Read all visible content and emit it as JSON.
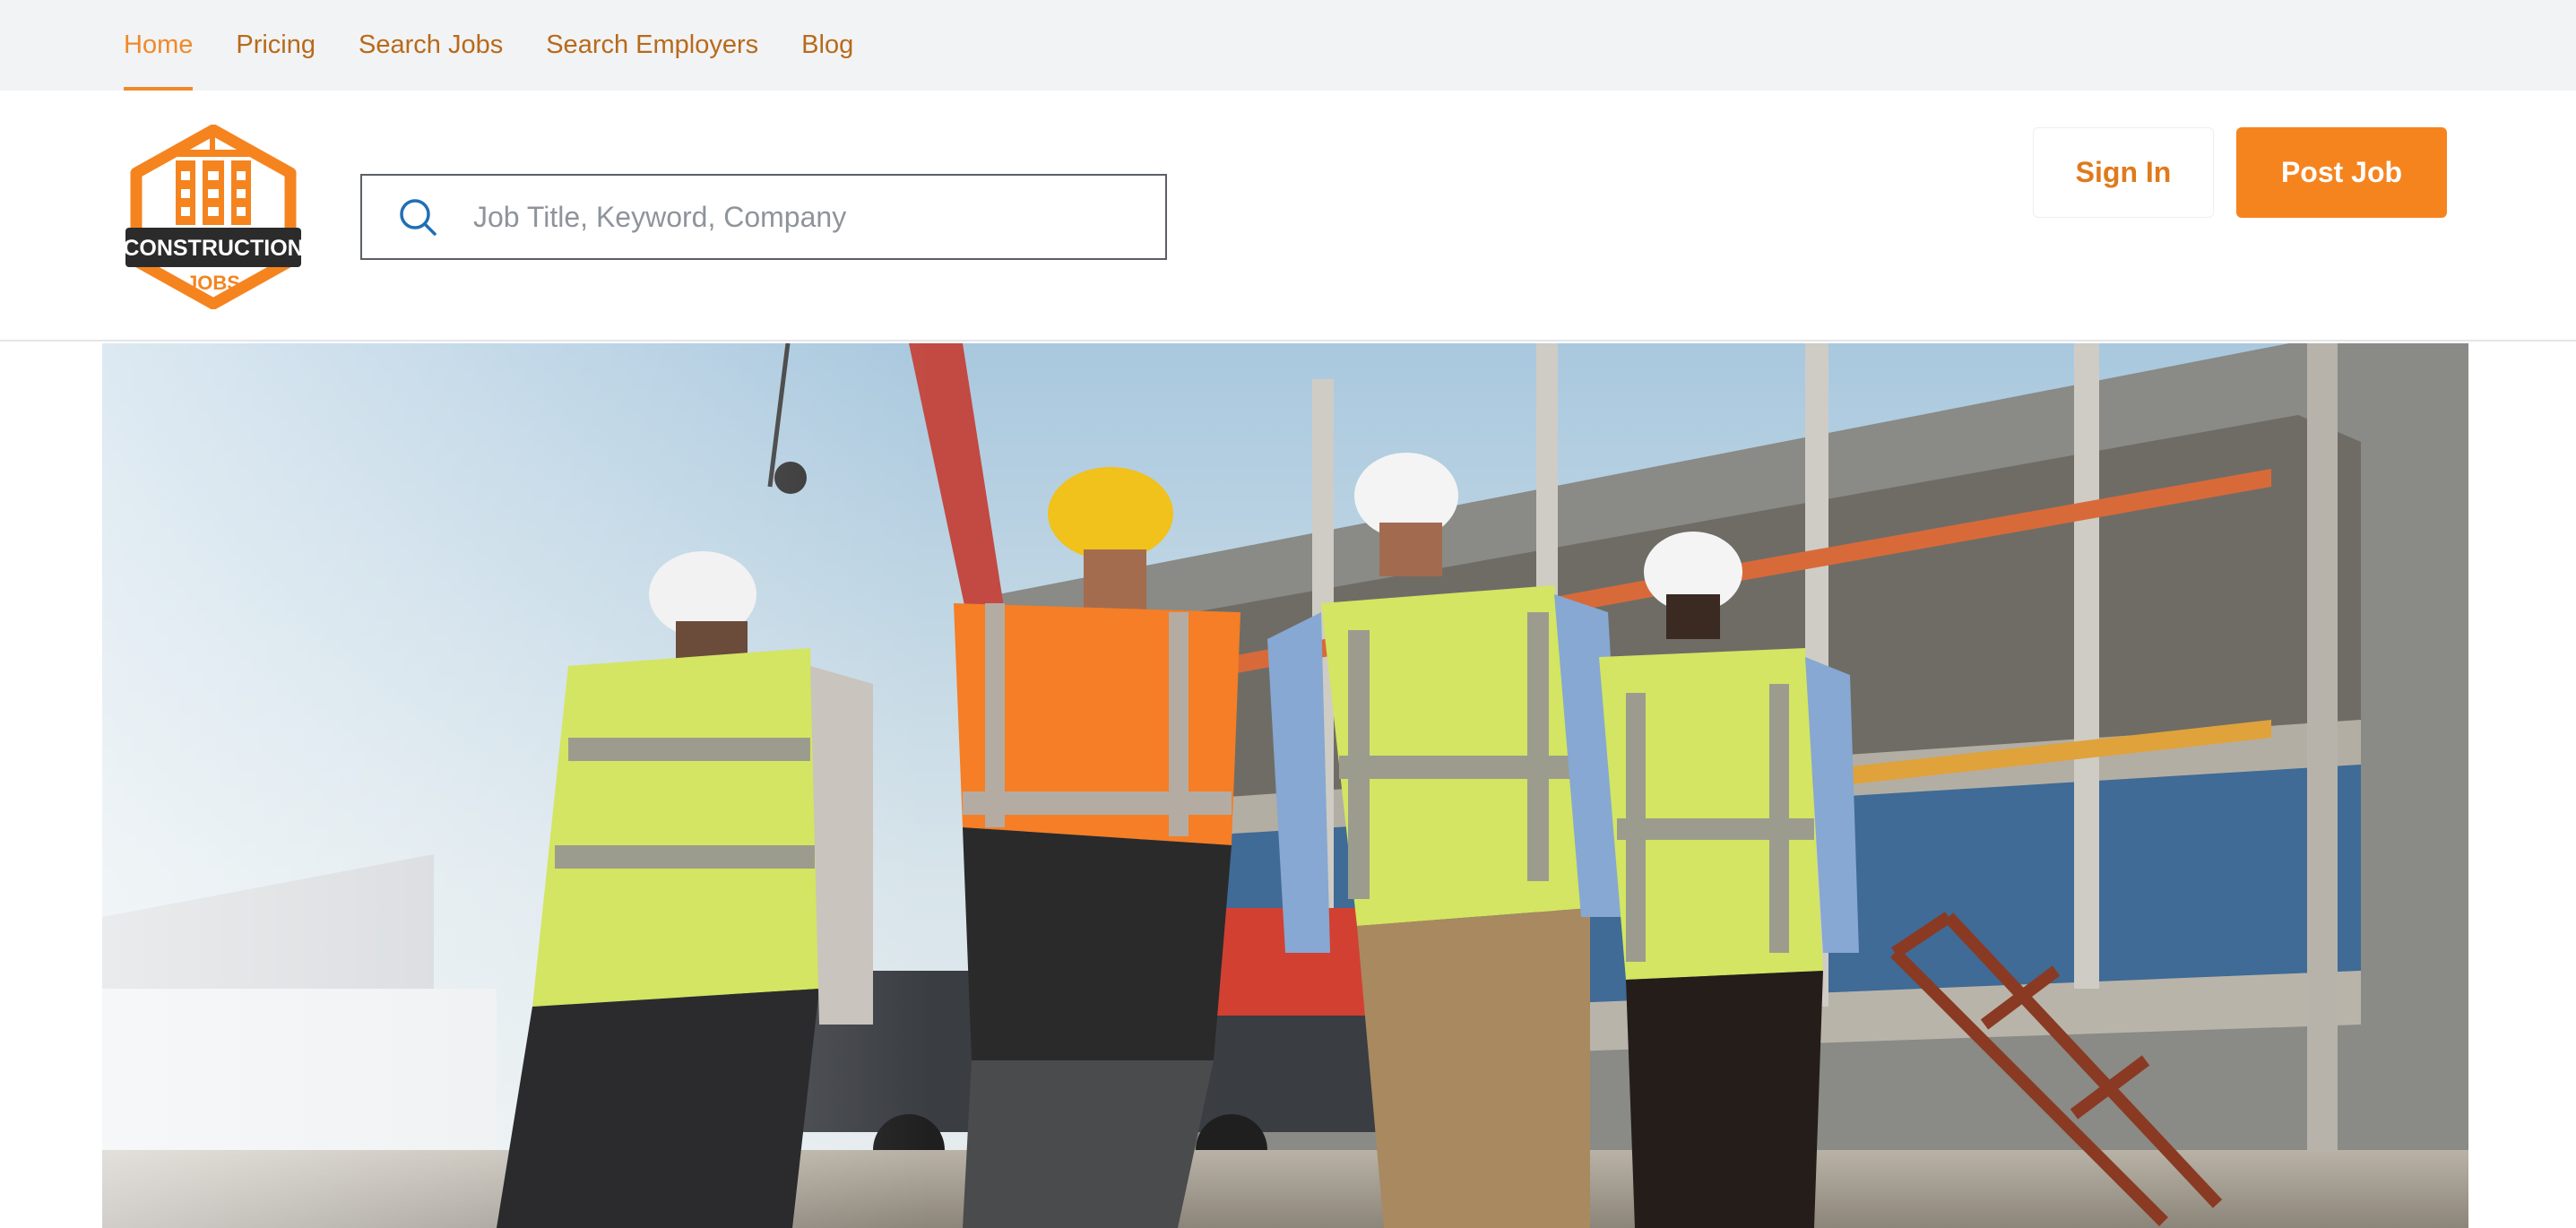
{
  "nav": {
    "items": [
      {
        "label": "Home",
        "active": true
      },
      {
        "label": "Pricing",
        "active": false
      },
      {
        "label": "Search Jobs",
        "active": false
      },
      {
        "label": "Search Employers",
        "active": false
      },
      {
        "label": "Blog",
        "active": false
      }
    ]
  },
  "logo": {
    "line1": "CONSTRUCTION",
    "line2": "JOBS",
    "icon": "building-hexagon-logo"
  },
  "search": {
    "placeholder": "Job Title, Keyword, Company",
    "value": "",
    "icon": "search-icon"
  },
  "header": {
    "sign_in_label": "Sign In",
    "post_job_label": "Post Job"
  },
  "hero": {
    "image": "construction-workers-walking-toward-building-site"
  },
  "colors": {
    "brand_orange": "#f5841f",
    "nav_text": "#b86a1a",
    "nav_active": "#f0892a",
    "topbar_bg": "#f2f3f5",
    "logo_dark": "#2b2b2b",
    "search_icon": "#1f6fb5"
  }
}
